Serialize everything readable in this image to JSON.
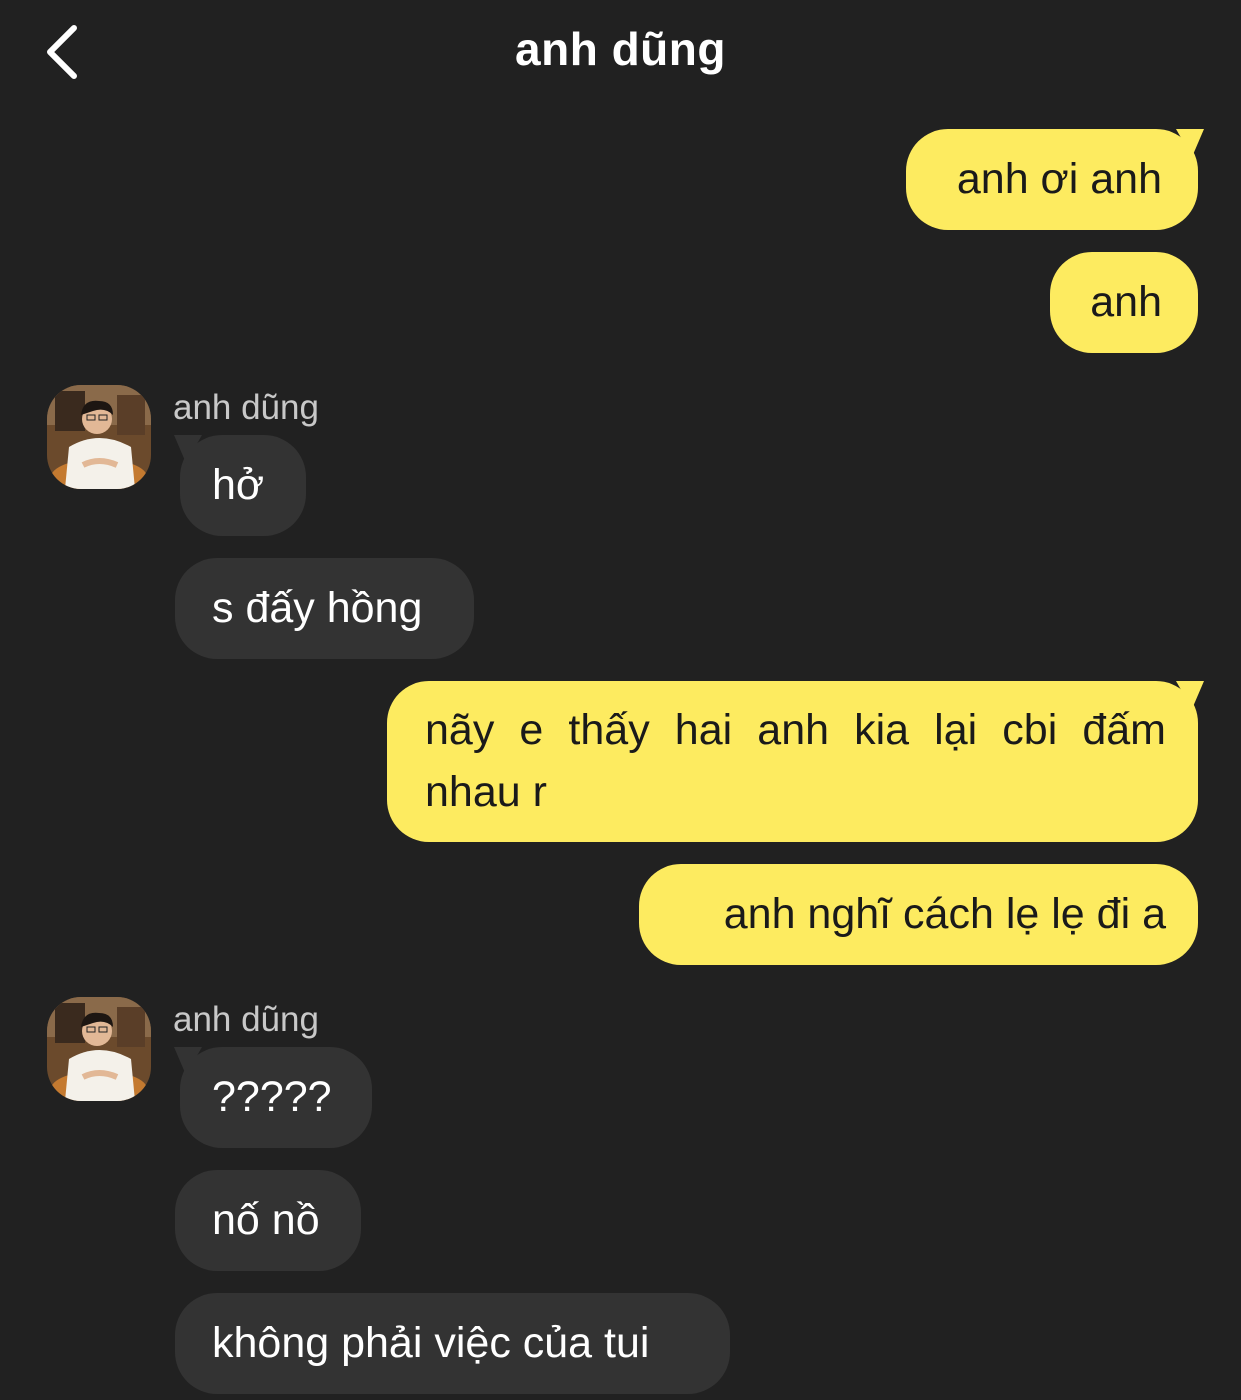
{
  "header": {
    "title": "anh dũng",
    "back_icon": "chevron-left-icon"
  },
  "colors": {
    "background": "#212121",
    "outgoing_bubble": "#FDEB60",
    "incoming_bubble": "#333333",
    "outgoing_text": "#1a1a1a",
    "incoming_text": "#ffffff",
    "sender_name": "#c8c8c8"
  },
  "messages": [
    {
      "from": "me",
      "text": "anh ơi anh"
    },
    {
      "from": "me",
      "text": "anh"
    },
    {
      "from": "them",
      "sender": "anh dũng",
      "text": "hở"
    },
    {
      "from": "them",
      "text": "s đấy hồng"
    },
    {
      "from": "me",
      "text": "nãy e thấy hai anh kia lại cbi đấm nhau r"
    },
    {
      "from": "me",
      "text": "anh nghĩ cách lẹ lẹ đi a"
    },
    {
      "from": "them",
      "sender": "anh dũng",
      "text": "?????"
    },
    {
      "from": "them",
      "text": "nố nồ"
    },
    {
      "from": "them",
      "text": "không phải việc của tui"
    }
  ]
}
